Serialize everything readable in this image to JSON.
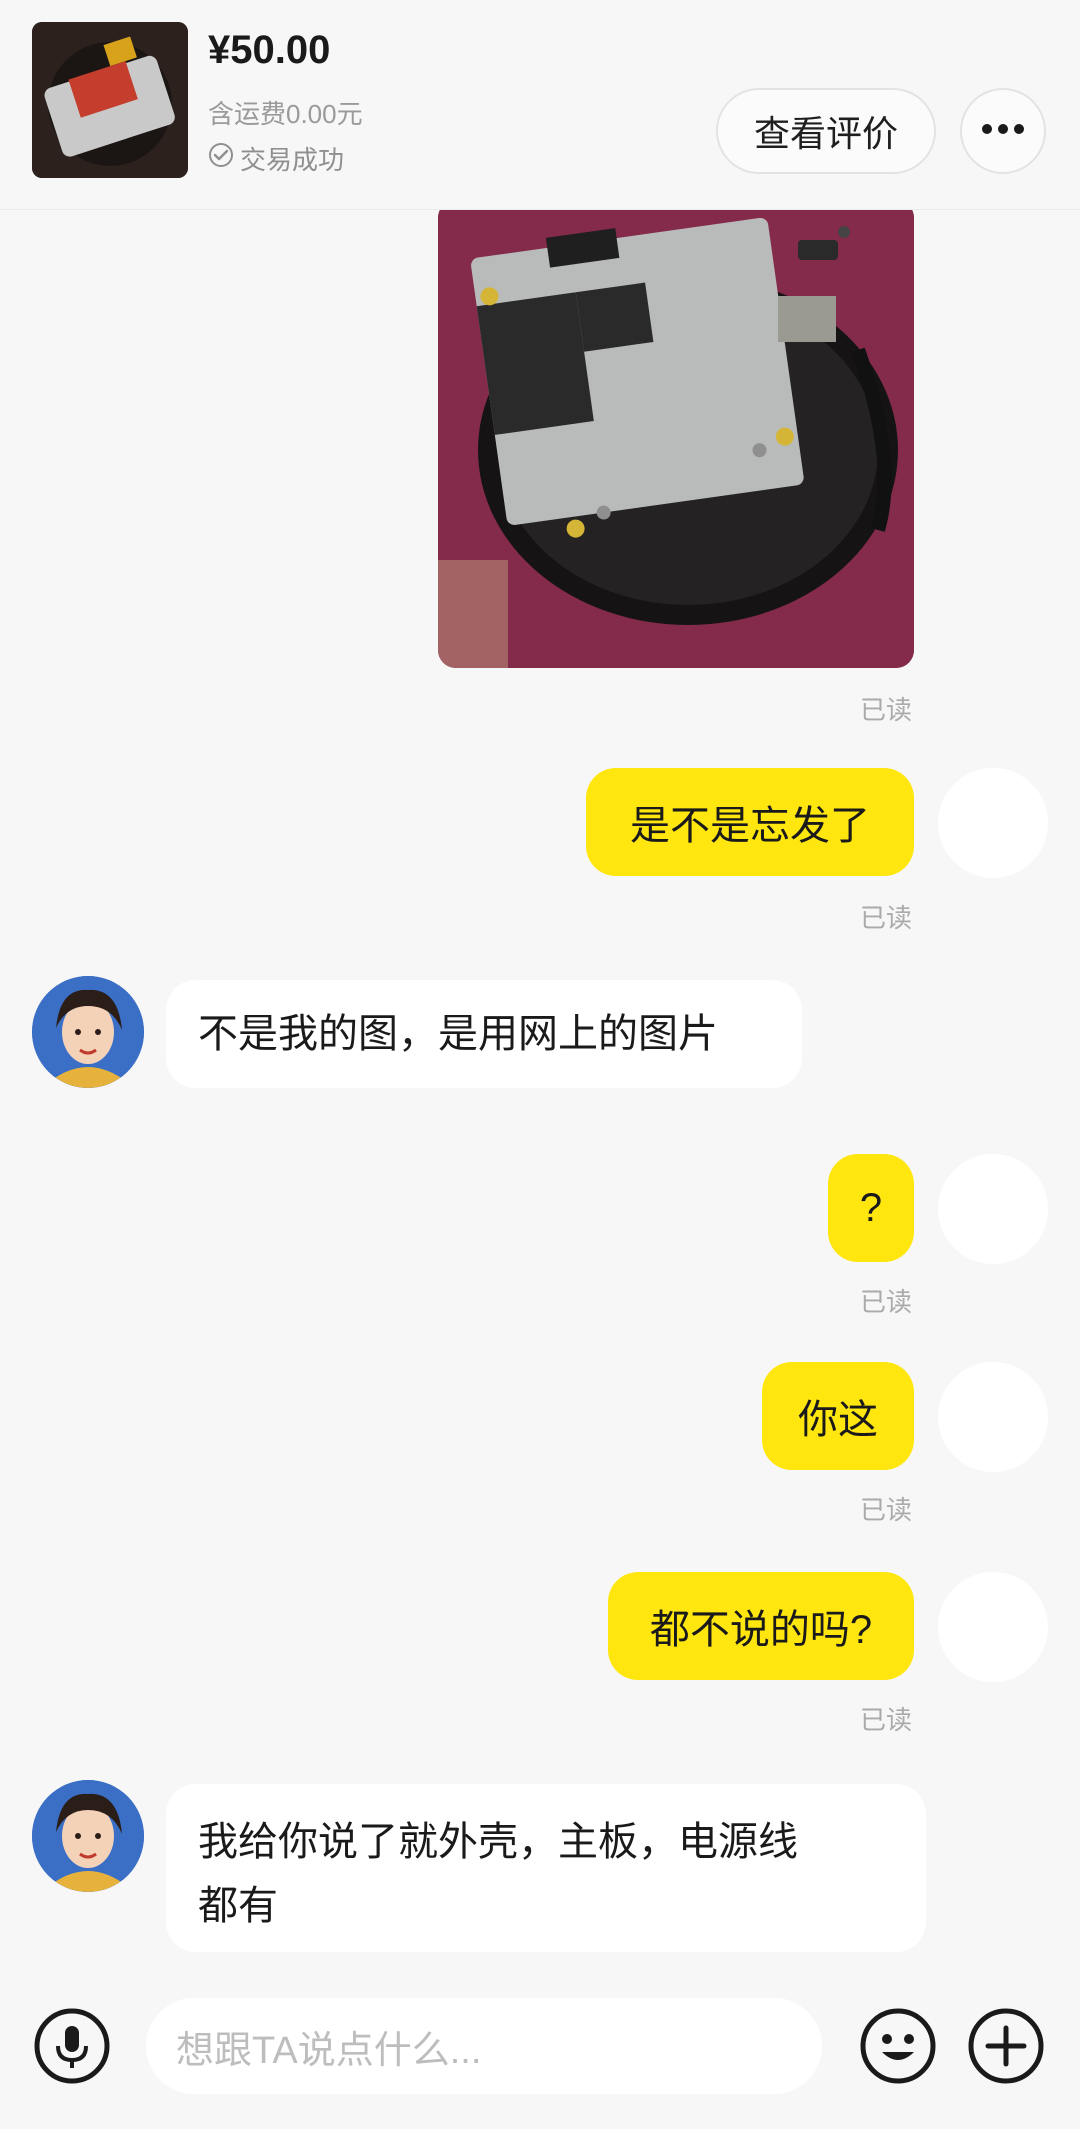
{
  "header": {
    "price": "¥50.00",
    "shipping": "含运费0.00元",
    "status": "交易成功",
    "review_button": "查看评价",
    "thumbnail_icon": "product-thumbnail"
  },
  "messages": [
    {
      "side": "right",
      "type": "image",
      "read": "已读"
    },
    {
      "side": "right",
      "type": "text",
      "text": "是不是忘发了",
      "read": "已读"
    },
    {
      "side": "left",
      "type": "text",
      "text": "不是我的图，是用网上的图片"
    },
    {
      "side": "right",
      "type": "text",
      "text": "?",
      "read": "已读"
    },
    {
      "side": "right",
      "type": "text",
      "text": "你这",
      "read": "已读"
    },
    {
      "side": "right",
      "type": "text",
      "text": "都不说的吗?",
      "read": "已读"
    },
    {
      "side": "left",
      "type": "text",
      "text": "我给你说了就外壳，主板，电源线\n都有"
    }
  ],
  "input": {
    "placeholder": "想跟TA说点什么..."
  },
  "colors": {
    "accent": "#ffe60f",
    "background": "#f7f7f7",
    "bubble_other": "#ffffff",
    "muted": "#aaaaaa"
  },
  "icons": [
    "check-circle-icon",
    "more-dots-icon",
    "microphone-icon",
    "emoji-icon",
    "plus-icon"
  ]
}
